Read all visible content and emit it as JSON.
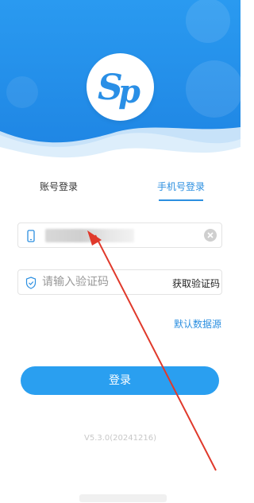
{
  "tabs": {
    "account": "账号登录",
    "phone": "手机号登录",
    "active": "phone"
  },
  "phone_field": {
    "value": "",
    "clear_icon": "clear-icon"
  },
  "code_field": {
    "placeholder": "请输入验证码",
    "get_code_label": "获取验证码"
  },
  "default_source_label": "默认数据源",
  "login_label": "登录",
  "version": "V5.3.0(20241216)",
  "logo_text": "Sp",
  "colors": {
    "accent": "#2c8fe0",
    "button": "#2a9ff0",
    "header": "#1e90ea",
    "annotation_arrow": "#e0392b"
  }
}
